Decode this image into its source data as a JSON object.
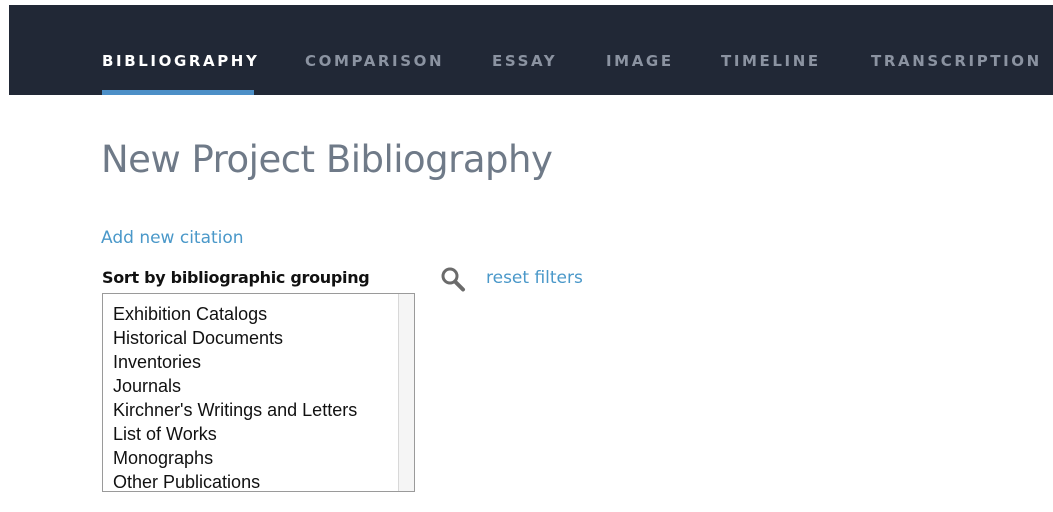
{
  "nav": {
    "tabs": [
      {
        "label": "BIBLIOGRAPHY",
        "active": true
      },
      {
        "label": "COMPARISON",
        "active": false
      },
      {
        "label": "ESSAY",
        "active": false
      },
      {
        "label": "IMAGE",
        "active": false
      },
      {
        "label": "TIMELINE",
        "active": false
      },
      {
        "label": "TRANSCRIPTION",
        "active": false
      }
    ]
  },
  "page": {
    "title": "New Project Bibliography",
    "add_citation": "Add new citation"
  },
  "filter": {
    "sort_label": "Sort by bibliographic grouping",
    "search_icon": "search-icon",
    "reset_label": "reset filters",
    "options": [
      "Exhibition Catalogs",
      "Historical Documents",
      "Inventories",
      "Journals",
      "Kirchner's Writings and Letters",
      "List of Works",
      "Monographs",
      "Other Publications"
    ]
  },
  "colors": {
    "nav_background": "#212836",
    "active_tab": "#ffffff",
    "inactive_tab": "#8b93a1",
    "accent": "#4c8fc7",
    "link": "#4a98c9",
    "title": "#6f7a88"
  }
}
